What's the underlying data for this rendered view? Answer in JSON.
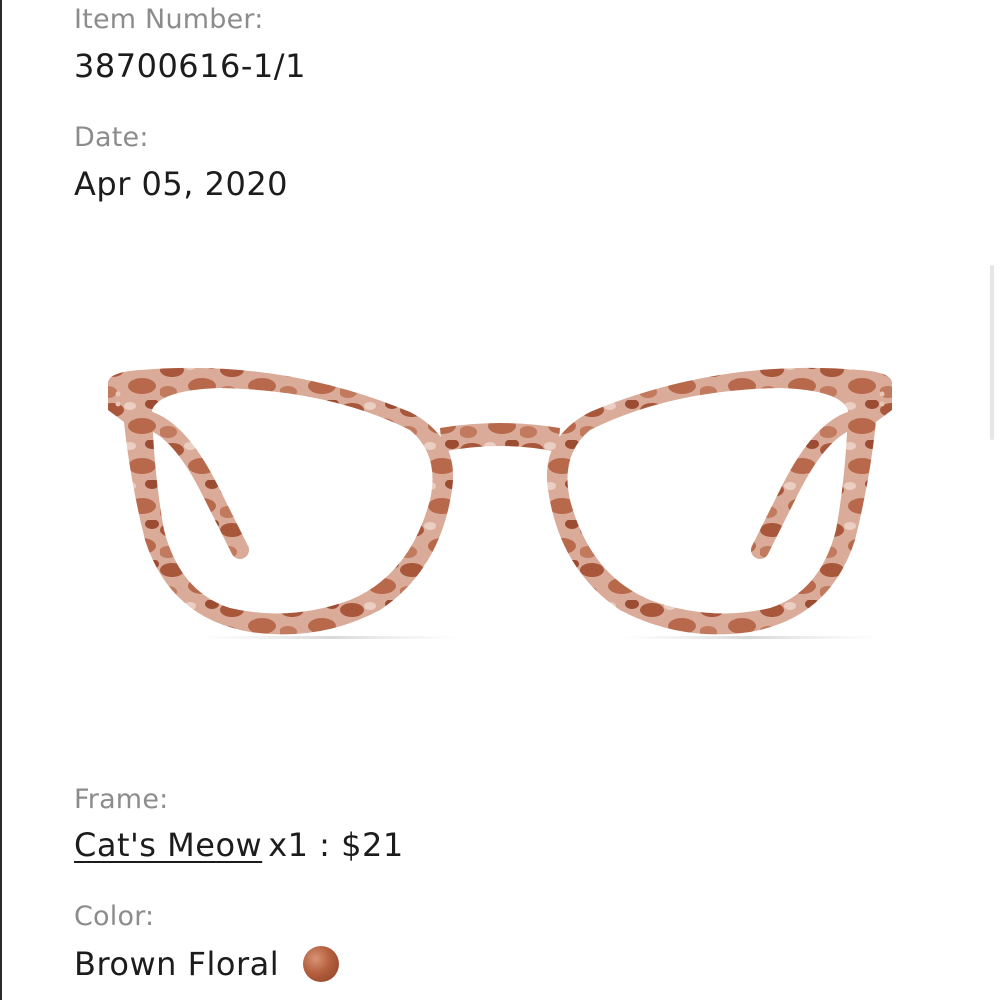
{
  "order_item": {
    "item_number_label": "Item Number:",
    "item_number_value": "38700616-1/1",
    "date_label": "Date:",
    "date_value": "Apr 05, 2020",
    "frame_label": "Frame:",
    "frame_name": "Cat's Meow",
    "frame_quantity": "x1",
    "frame_price_sep": " : ",
    "frame_price": "$21",
    "color_label": "Color:",
    "color_value": "Brown Floral",
    "color_swatch_hex": "#b45f3e"
  },
  "product_image": {
    "icon": "eyeglasses-image",
    "frame_colors": [
      "#a0553d",
      "#d9a895",
      "#c98670"
    ]
  }
}
